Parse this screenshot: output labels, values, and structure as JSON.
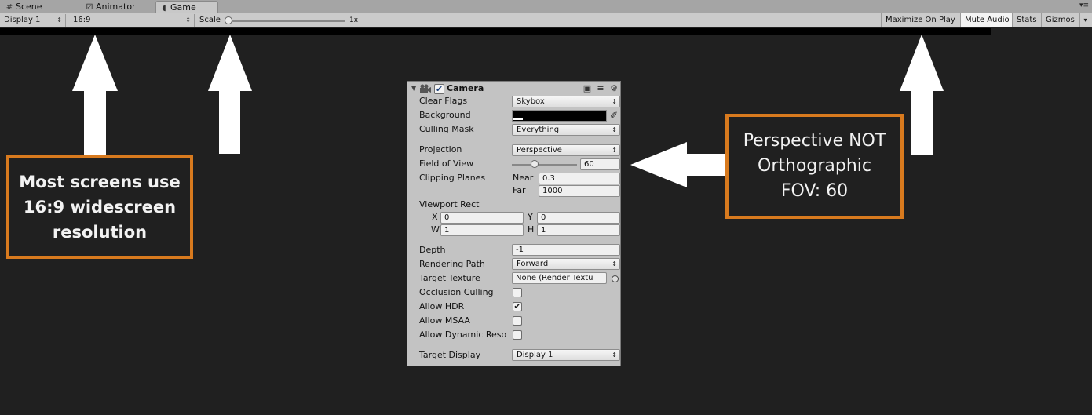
{
  "tabs": [
    {
      "label": "Scene",
      "icon": "grid-icon"
    },
    {
      "label": "Animator",
      "icon": "animator-icon"
    },
    {
      "label": "Game",
      "icon": "pacman-icon",
      "active": true
    }
  ],
  "toolbar": {
    "display": "Display 1",
    "aspect": "16:9",
    "scale_label": "Scale",
    "scale_value": "1x",
    "maximize_on_play": "Maximize On Play",
    "mute_audio": "Mute Audio",
    "stats": "Stats",
    "gizmos": "Gizmos"
  },
  "callouts": {
    "left_lines": [
      "Most screens use",
      "16:9 widescreen",
      "resolution"
    ],
    "right_lines": [
      "Perspective NOT",
      "Orthographic",
      "FOV: 60"
    ],
    "border_color": "#d87a1e"
  },
  "camera": {
    "component_title": "Camera",
    "enabled": true,
    "clear_flags_label": "Clear Flags",
    "clear_flags_value": "Skybox",
    "background_label": "Background",
    "background_color": "#000000",
    "culling_mask_label": "Culling Mask",
    "culling_mask_value": "Everything",
    "projection_label": "Projection",
    "projection_value": "Perspective",
    "fov_label": "Field of View",
    "fov_value": "60",
    "clipping_label": "Clipping Planes",
    "near_label": "Near",
    "near_value": "0.3",
    "far_label": "Far",
    "far_value": "1000",
    "viewport_label": "Viewport Rect",
    "x_label": "X",
    "x_value": "0",
    "y_label": "Y",
    "y_value": "0",
    "w_label": "W",
    "w_value": "1",
    "h_label": "H",
    "h_value": "1",
    "depth_label": "Depth",
    "depth_value": "-1",
    "rendering_path_label": "Rendering Path",
    "rendering_path_value": "Forward",
    "target_texture_label": "Target Texture",
    "target_texture_value": "None (Render Textu",
    "occlusion_label": "Occlusion Culling",
    "occlusion_checked": false,
    "hdr_label": "Allow HDR",
    "hdr_checked": true,
    "msaa_label": "Allow MSAA",
    "msaa_checked": false,
    "dynres_label": "Allow Dynamic Reso",
    "dynres_checked": false,
    "target_display_label": "Target Display",
    "target_display_value": "Display 1"
  }
}
